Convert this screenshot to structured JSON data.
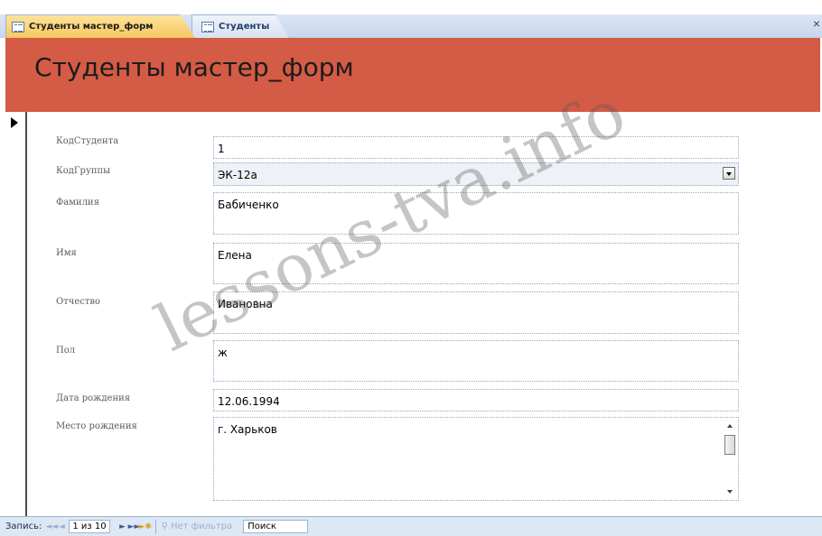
{
  "tabs": [
    {
      "label": "Студенты мастер_форм",
      "active": true,
      "icon": "form-icon"
    },
    {
      "label": "Студенты",
      "active": false,
      "icon": "form-icon"
    }
  ],
  "window": {
    "close_label": "×"
  },
  "header": {
    "title": "Студенты мастер_форм",
    "bg_color": "#d45b45"
  },
  "fields": [
    {
      "label": "КодСтудента",
      "value": "1"
    },
    {
      "label": "КодГруппы",
      "value": "ЭК-12а"
    },
    {
      "label": "Фамилия",
      "value": "Бабиченко"
    },
    {
      "label": "Имя",
      "value": "Елена"
    },
    {
      "label": "Отчество",
      "value": "Ивановна"
    },
    {
      "label": "Пол",
      "value": "ж"
    },
    {
      "label": "Дата рождения",
      "value": "12.06.1994"
    },
    {
      "label": "Место рождения",
      "value": "г. Харьков"
    }
  ],
  "watermark": "lessons-tva.info",
  "navigation": {
    "label": "Запись:",
    "position": "1 из 10",
    "first": "◄◄",
    "prev": "◄",
    "next": "►",
    "last": "►►",
    "new": "►✱",
    "filter_label": "Нет фильтра",
    "search_placeholder": "Поиск"
  }
}
